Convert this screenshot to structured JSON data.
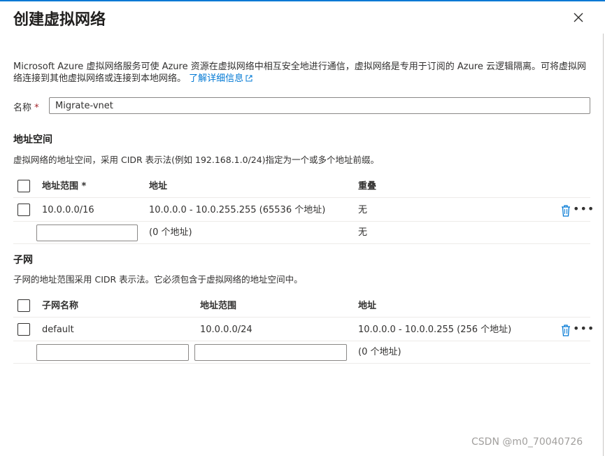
{
  "title": "创建虚拟网络",
  "description": "Microsoft Azure 虚拟网络服务可使 Azure 资源在虚拟网络中相互安全地进行通信，虚拟网络是专用于订阅的 Azure 云逻辑隔离。可将虚拟网络连接到其他虚拟网络或连接到本地网络。",
  "learn_more": "了解详细信息",
  "name_field": {
    "label": "名称",
    "required_mark": "*",
    "value": "Migrate-vnet"
  },
  "address_space": {
    "title": "地址空间",
    "description": "虚拟网络的地址空间，采用 CIDR 表示法(例如 192.168.1.0/24)指定为一个或多个地址前缀。",
    "headers": {
      "range": "地址范围 *",
      "address": "地址",
      "overlap": "重叠"
    },
    "rows": [
      {
        "range": "10.0.0.0/16",
        "address": "10.0.0.0 - 10.0.255.255 (65536 个地址)",
        "overlap": "无"
      }
    ],
    "new_row": {
      "range_value": "",
      "address": "(0 个地址)",
      "overlap": "无"
    }
  },
  "subnet": {
    "title": "子网",
    "description": "子网的地址范围采用 CIDR 表示法。它必须包含于虚拟网络的地址空间中。",
    "headers": {
      "name": "子网名称",
      "range": "地址范围",
      "address": "地址"
    },
    "rows": [
      {
        "name": "default",
        "range": "10.0.0.0/24",
        "address": "10.0.0.0 - 10.0.0.255 (256 个地址)"
      }
    ],
    "new_row": {
      "name_value": "",
      "range_value": "",
      "address": "(0 个地址)"
    }
  },
  "more_label": "•••",
  "watermark": "CSDN @m0_70040726",
  "icons": {
    "close": "close-icon",
    "external": "external-link-icon",
    "delete": "trash-icon",
    "more": "more-icon"
  },
  "colors": {
    "accent": "#0078d4",
    "required": "#a4262c",
    "border": "#8a8886"
  }
}
